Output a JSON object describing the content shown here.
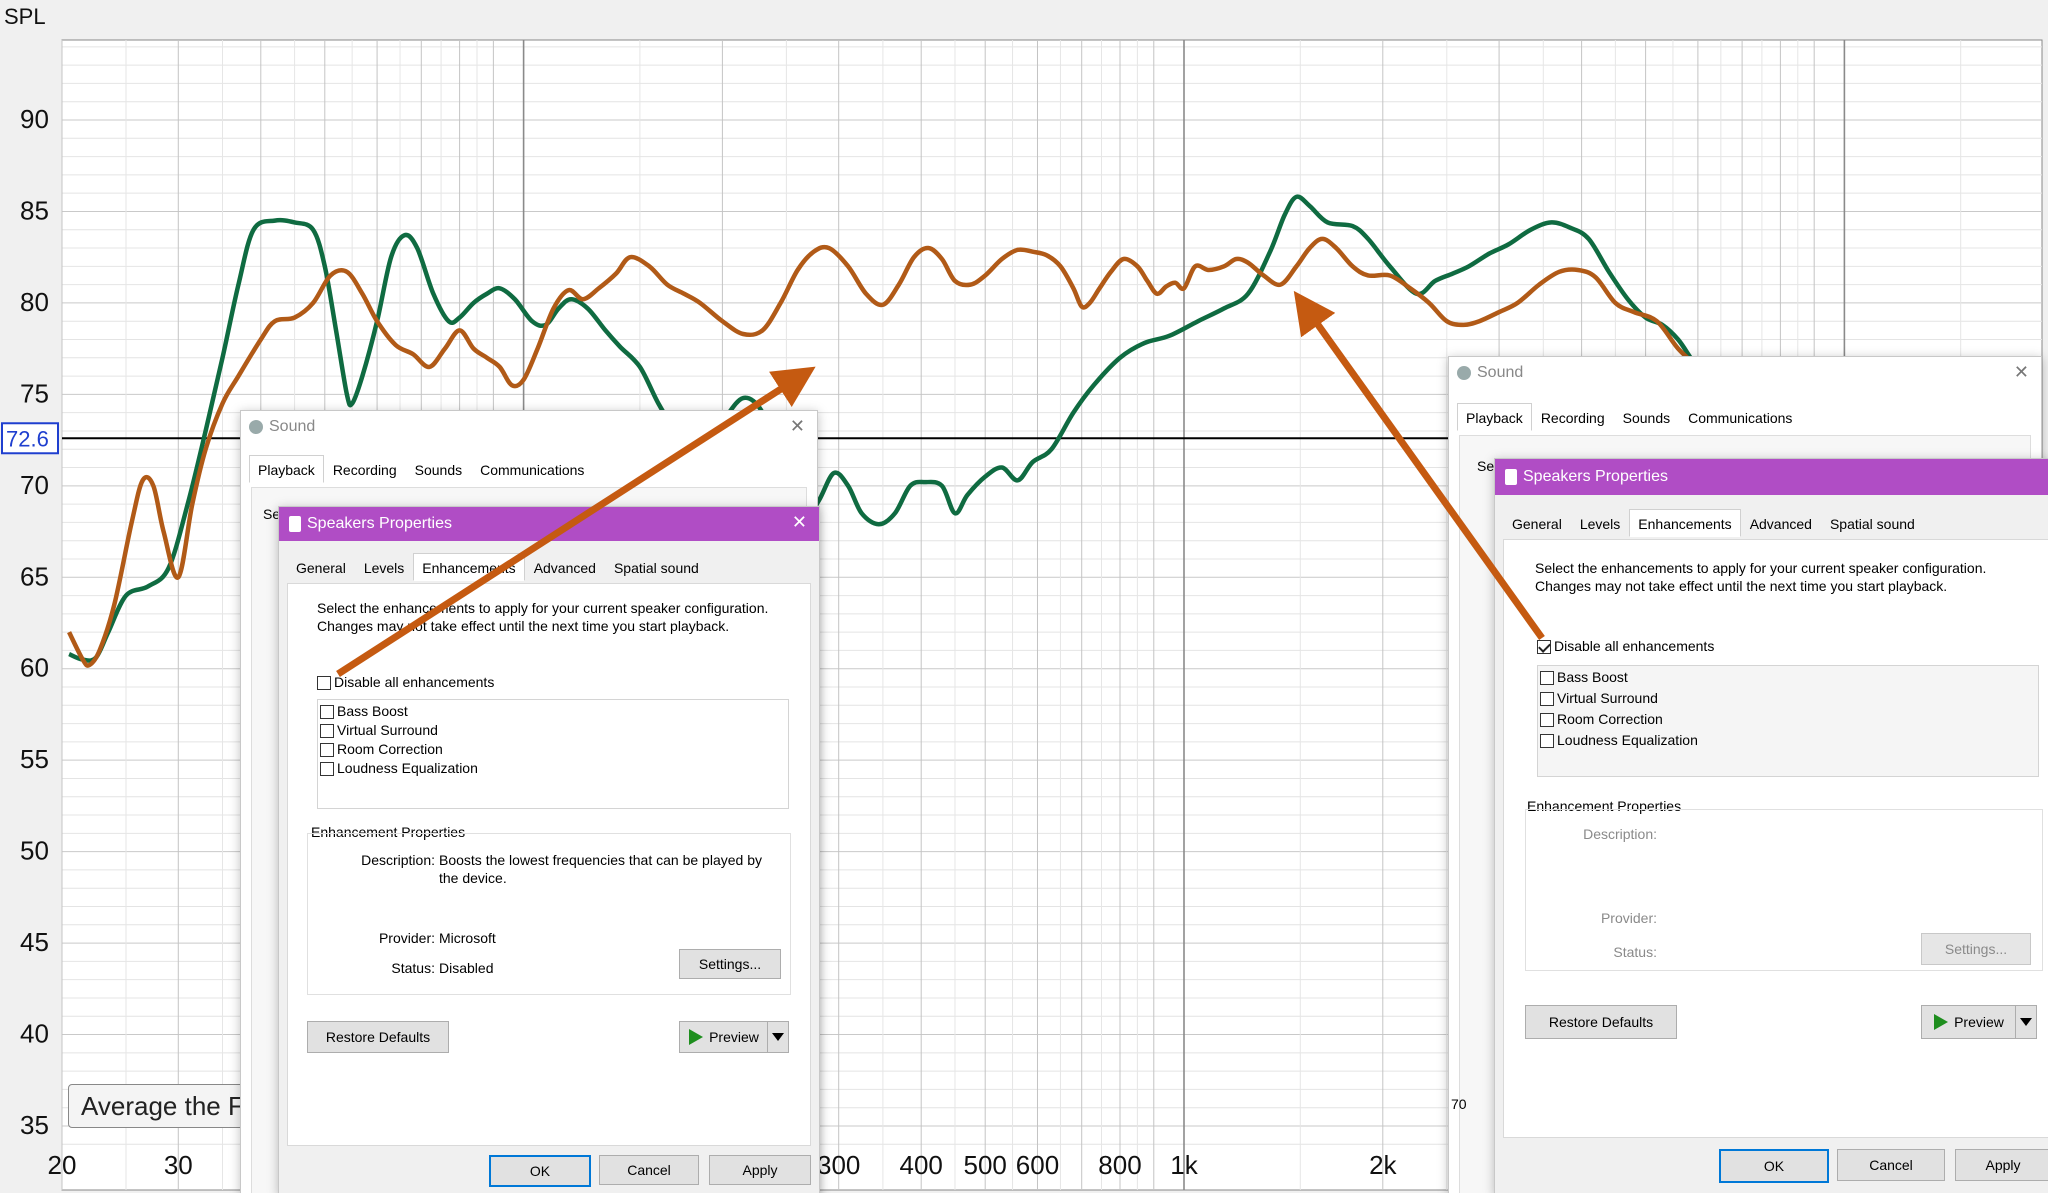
{
  "chart_data": {
    "type": "line",
    "ylabel": "SPL",
    "xscale": "log",
    "xlim": [
      20,
      20000
    ],
    "ylim": [
      35,
      95
    ],
    "x_ticks": [
      {
        "v": 20,
        "label": "20"
      },
      {
        "v": 30,
        "label": "30"
      },
      {
        "v": 300,
        "label": "300"
      },
      {
        "v": 400,
        "label": "400"
      },
      {
        "v": 500,
        "label": "500"
      },
      {
        "v": 600,
        "label": "600"
      },
      {
        "v": 800,
        "label": "800"
      },
      {
        "v": 1000,
        "label": "1k"
      },
      {
        "v": 2000,
        "label": "2k"
      }
    ],
    "y_ticks": [
      35,
      40,
      45,
      50,
      55,
      60,
      65,
      70,
      75,
      80,
      85,
      90
    ],
    "cursor_value": "72.6",
    "grid": true,
    "series": [
      {
        "color": "#0f6b41",
        "points": [
          [
            20.5,
            60.8
          ],
          [
            21.5,
            60.5
          ],
          [
            22.5,
            60.6
          ],
          [
            23.5,
            62
          ],
          [
            25,
            64
          ],
          [
            27,
            64.5
          ],
          [
            29,
            65.5
          ],
          [
            31,
            69
          ],
          [
            33,
            73
          ],
          [
            35,
            77
          ],
          [
            37,
            81
          ],
          [
            39,
            84
          ],
          [
            42,
            84.5
          ],
          [
            45,
            84.4
          ],
          [
            48,
            84
          ],
          [
            50,
            82
          ],
          [
            52,
            78.5
          ],
          [
            54,
            75
          ],
          [
            55,
            74.5
          ],
          [
            57,
            76
          ],
          [
            60,
            79
          ],
          [
            63,
            82.5
          ],
          [
            66,
            83.7
          ],
          [
            69,
            83
          ],
          [
            73,
            80.5
          ],
          [
            77,
            79
          ],
          [
            80,
            79.2
          ],
          [
            84,
            80
          ],
          [
            88,
            80.5
          ],
          [
            92,
            80.8
          ],
          [
            97,
            80.2
          ],
          [
            103,
            79
          ],
          [
            108,
            78.8
          ],
          [
            113,
            79.7
          ],
          [
            118,
            80.2
          ],
          [
            125,
            79.7
          ],
          [
            133,
            78.5
          ],
          [
            140,
            77.6
          ],
          [
            150,
            76.5
          ],
          [
            160,
            74.5
          ],
          [
            170,
            73
          ],
          [
            180,
            72.2
          ],
          [
            190,
            72.5
          ],
          [
            200,
            73.5
          ],
          [
            215,
            74.8
          ],
          [
            230,
            74
          ],
          [
            240,
            71.5
          ],
          [
            250,
            69
          ],
          [
            265,
            68
          ],
          [
            280,
            69.2
          ],
          [
            295,
            70.7
          ],
          [
            310,
            70
          ],
          [
            325,
            68.5
          ],
          [
            345,
            67.9
          ],
          [
            365,
            68.5
          ],
          [
            385,
            70
          ],
          [
            405,
            70.2
          ],
          [
            430,
            70
          ],
          [
            450,
            68.5
          ],
          [
            470,
            69.5
          ],
          [
            500,
            70.5
          ],
          [
            530,
            71
          ],
          [
            560,
            70.3
          ],
          [
            590,
            71.3
          ],
          [
            630,
            72
          ],
          [
            680,
            74
          ],
          [
            730,
            75.5
          ],
          [
            800,
            77
          ],
          [
            870,
            77.8
          ],
          [
            950,
            78.2
          ],
          [
            1050,
            79
          ],
          [
            1150,
            79.7
          ],
          [
            1250,
            80.5
          ],
          [
            1350,
            82.8
          ],
          [
            1420,
            84.8
          ],
          [
            1480,
            85.8
          ],
          [
            1550,
            85.3
          ],
          [
            1650,
            84.4
          ],
          [
            1800,
            84.2
          ],
          [
            1900,
            83.5
          ],
          [
            2050,
            82
          ],
          [
            2250,
            80.5
          ],
          [
            2400,
            81.2
          ],
          [
            2550,
            81.6
          ],
          [
            2700,
            82
          ],
          [
            2900,
            82.7
          ],
          [
            3100,
            83.2
          ],
          [
            3350,
            84
          ],
          [
            3600,
            84.4
          ],
          [
            3850,
            84.1
          ],
          [
            4100,
            83.5
          ],
          [
            4400,
            81.7
          ],
          [
            4700,
            80.2
          ],
          [
            5000,
            79.2
          ],
          [
            5300,
            78.8
          ],
          [
            5600,
            78
          ],
          [
            5850,
            77
          ],
          [
            6000,
            76.5
          ]
        ]
      },
      {
        "color": "#b15a17",
        "points": [
          [
            20.5,
            62
          ],
          [
            21.5,
            60.5
          ],
          [
            22,
            60.2
          ],
          [
            22.8,
            61
          ],
          [
            24,
            63.5
          ],
          [
            25.5,
            68
          ],
          [
            26.5,
            70.3
          ],
          [
            27.5,
            70
          ],
          [
            28.5,
            67.5
          ],
          [
            30,
            65
          ],
          [
            31.5,
            69
          ],
          [
            33,
            72
          ],
          [
            35,
            74.5
          ],
          [
            37,
            76
          ],
          [
            40,
            78
          ],
          [
            42,
            79
          ],
          [
            45,
            79.2
          ],
          [
            48,
            80
          ],
          [
            51,
            81.5
          ],
          [
            54,
            81.7
          ],
          [
            57,
            80.5
          ],
          [
            60,
            79
          ],
          [
            64,
            77.7
          ],
          [
            68,
            77.2
          ],
          [
            72,
            76.5
          ],
          [
            76,
            77.5
          ],
          [
            80,
            78.5
          ],
          [
            84,
            77.5
          ],
          [
            88,
            77
          ],
          [
            92,
            76.5
          ],
          [
            96,
            75.5
          ],
          [
            100,
            75.8
          ],
          [
            105,
            77.5
          ],
          [
            111,
            79.7
          ],
          [
            117,
            80.7
          ],
          [
            123,
            80.2
          ],
          [
            130,
            80.8
          ],
          [
            138,
            81.6
          ],
          [
            145,
            82.5
          ],
          [
            155,
            82
          ],
          [
            165,
            81
          ],
          [
            175,
            80.5
          ],
          [
            185,
            80
          ],
          [
            200,
            79
          ],
          [
            215,
            78.3
          ],
          [
            230,
            78.5
          ],
          [
            245,
            80
          ],
          [
            260,
            81.8
          ],
          [
            275,
            82.8
          ],
          [
            290,
            83
          ],
          [
            310,
            82
          ],
          [
            330,
            80.5
          ],
          [
            350,
            79.9
          ],
          [
            370,
            81
          ],
          [
            390,
            82.5
          ],
          [
            410,
            83
          ],
          [
            430,
            82.4
          ],
          [
            450,
            81.2
          ],
          [
            475,
            81
          ],
          [
            500,
            81.5
          ],
          [
            530,
            82.4
          ],
          [
            560,
            82.9
          ],
          [
            590,
            82.8
          ],
          [
            620,
            82.6
          ],
          [
            650,
            82
          ],
          [
            680,
            80.8
          ],
          [
            700,
            79.8
          ],
          [
            720,
            80
          ],
          [
            745,
            80.8
          ],
          [
            775,
            81.7
          ],
          [
            810,
            82.4
          ],
          [
            850,
            82
          ],
          [
            880,
            81.2
          ],
          [
            910,
            80.5
          ],
          [
            940,
            80.9
          ],
          [
            970,
            81.1
          ],
          [
            1000,
            80.8
          ],
          [
            1040,
            82
          ],
          [
            1090,
            81.8
          ],
          [
            1150,
            82
          ],
          [
            1200,
            82.4
          ],
          [
            1250,
            82.2
          ],
          [
            1320,
            81.5
          ],
          [
            1400,
            81
          ],
          [
            1480,
            82
          ],
          [
            1550,
            83
          ],
          [
            1620,
            83.5
          ],
          [
            1700,
            83
          ],
          [
            1800,
            82
          ],
          [
            1900,
            81.5
          ],
          [
            2050,
            81.5
          ],
          [
            2200,
            80.8
          ],
          [
            2350,
            80
          ],
          [
            2500,
            79
          ],
          [
            2650,
            78.8
          ],
          [
            2800,
            79
          ],
          [
            3000,
            79.5
          ],
          [
            3200,
            80
          ],
          [
            3450,
            81
          ],
          [
            3700,
            81.7
          ],
          [
            3950,
            81.8
          ],
          [
            4200,
            81.4
          ],
          [
            4500,
            80
          ],
          [
            4800,
            79.5
          ],
          [
            5200,
            79
          ],
          [
            5600,
            77.5
          ],
          [
            6000,
            76.5
          ]
        ]
      }
    ]
  },
  "chart_button": {
    "label": "Average the Fr"
  },
  "panel_right_edge": {
    "label": "70"
  },
  "dialog1": {
    "sound_title": "Sound",
    "sound_tabs": [
      "Playback",
      "Recording",
      "Sounds",
      "Communications"
    ],
    "sound_partial": "Se",
    "props_title": "Speakers Properties",
    "props_tabs": [
      "General",
      "Levels",
      "Enhancements",
      "Advanced",
      "Spatial sound"
    ],
    "instructions": "Select the enhancements to apply for your current speaker configuration. Changes may not take effect until the next time you start playback.",
    "disable_all": "Disable all enhancements",
    "disable_all_checked": false,
    "enhancements": [
      "Bass Boost",
      "Virtual Surround",
      "Room Correction",
      "Loudness Equalization"
    ],
    "group_title": "Enhancement Properties",
    "description_label": "Description:",
    "description_value": "Boosts the lowest frequencies that can be played by the device.",
    "provider_label": "Provider:",
    "provider_value": "Microsoft",
    "status_label": "Status:",
    "status_value": "Disabled",
    "settings_btn": "Settings...",
    "restore_btn": "Restore Defaults",
    "preview_btn": "Preview",
    "ok": "OK",
    "cancel": "Cancel",
    "apply": "Apply"
  },
  "dialog2": {
    "sound_title": "Sound",
    "sound_tabs": [
      "Playback",
      "Recording",
      "Sounds",
      "Communications"
    ],
    "sound_partial": "Se",
    "props_title": "Speakers Properties",
    "props_tabs": [
      "General",
      "Levels",
      "Enhancements",
      "Advanced",
      "Spatial sound"
    ],
    "instructions": "Select the enhancements to apply for your current speaker configuration. Changes may not take effect until the next time you start playback.",
    "disable_all": "Disable all enhancements",
    "disable_all_checked": true,
    "enhancements": [
      "Bass Boost",
      "Virtual Surround",
      "Room Correction",
      "Loudness Equalization"
    ],
    "group_title": "Enhancement Properties",
    "description_label": "Description:",
    "provider_label": "Provider:",
    "status_label": "Status:",
    "settings_btn": "Settings...",
    "restore_btn": "Restore Defaults",
    "preview_btn": "Preview",
    "ok": "OK",
    "cancel": "Cancel",
    "apply": "Apply"
  },
  "colors": {
    "arrow": "#c55a11",
    "plot_bg": "#ffffff",
    "grid": "#cfcfcf",
    "axis_bg": "#f0f0f0",
    "cursor_box": "#1f3fcf",
    "titlebar": "#b04dc5"
  }
}
